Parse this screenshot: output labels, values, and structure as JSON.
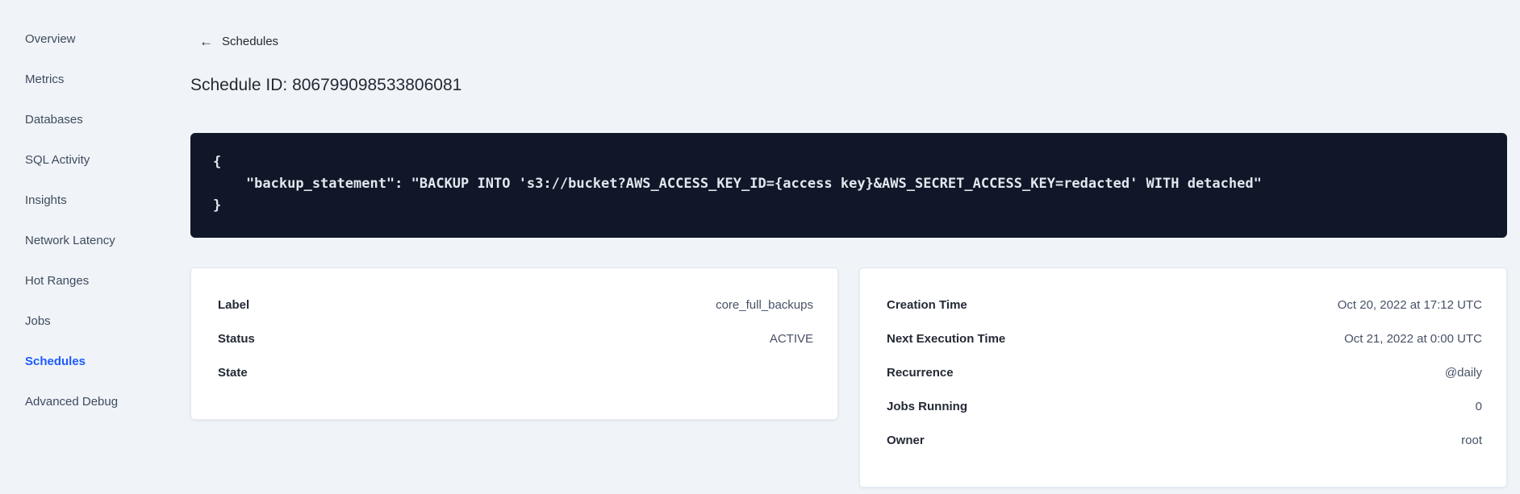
{
  "sidebar": {
    "items": [
      {
        "label": "Overview",
        "active": false
      },
      {
        "label": "Metrics",
        "active": false
      },
      {
        "label": "Databases",
        "active": false
      },
      {
        "label": "SQL Activity",
        "active": false
      },
      {
        "label": "Insights",
        "active": false
      },
      {
        "label": "Network Latency",
        "active": false
      },
      {
        "label": "Hot Ranges",
        "active": false
      },
      {
        "label": "Jobs",
        "active": false
      },
      {
        "label": "Schedules",
        "active": true
      },
      {
        "label": "Advanced Debug",
        "active": false
      }
    ]
  },
  "header": {
    "back_icon": "←",
    "back_label": "Schedules",
    "title": "Schedule ID: 806799098533806081"
  },
  "code_block": {
    "text": "{\n    \"backup_statement\": \"BACKUP INTO 's3://bucket?AWS_ACCESS_KEY_ID={access key}&AWS_SECRET_ACCESS_KEY=redacted' WITH detached\"\n}"
  },
  "cards": {
    "left": {
      "rows": [
        {
          "label": "Label",
          "value": "core_full_backups"
        },
        {
          "label": "Status",
          "value": "ACTIVE"
        },
        {
          "label": "State",
          "value": ""
        }
      ]
    },
    "right": {
      "rows": [
        {
          "label": "Creation Time",
          "value": "Oct 20, 2022 at 17:12 UTC"
        },
        {
          "label": "Next Execution Time",
          "value": "Oct 21, 2022 at 0:00 UTC"
        },
        {
          "label": "Recurrence",
          "value": "@daily"
        },
        {
          "label": "Jobs Running",
          "value": "0"
        },
        {
          "label": "Owner",
          "value": "root"
        }
      ]
    }
  },
  "colors": {
    "page_background": "#f0f4f8",
    "active_nav": "#1e5bff",
    "code_background": "#0f1728",
    "code_text": "#e2e7ee",
    "text_primary": "#242a35",
    "text_secondary": "#475166"
  }
}
